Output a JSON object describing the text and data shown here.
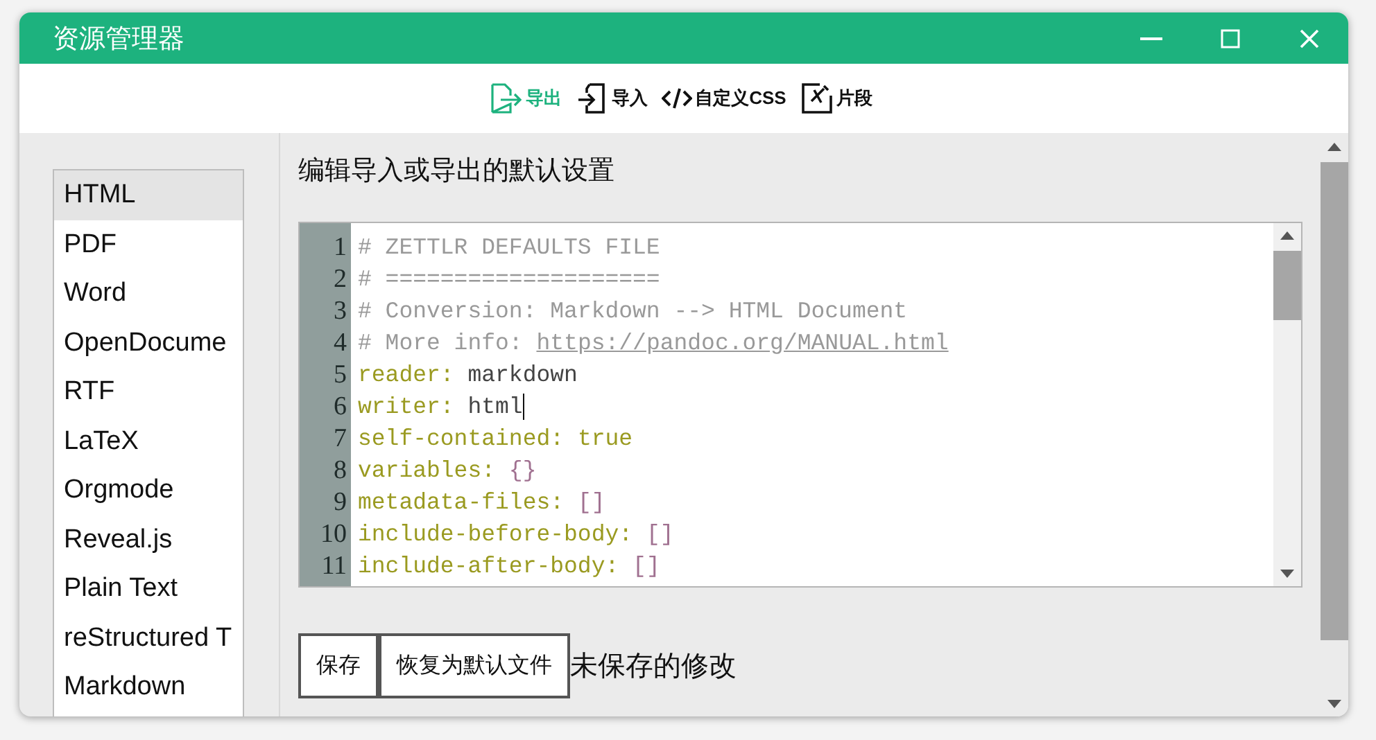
{
  "window": {
    "title": "资源管理器"
  },
  "toolbar": [
    {
      "label": "导出",
      "selected": true
    },
    {
      "label": "导入",
      "selected": false
    },
    {
      "label": "自定义CSS",
      "selected": false
    },
    {
      "label": "片段",
      "selected": false
    }
  ],
  "formats": [
    {
      "label": "HTML",
      "selected": true
    },
    {
      "label": "PDF",
      "selected": false
    },
    {
      "label": "Word",
      "selected": false
    },
    {
      "label": "OpenDocume",
      "selected": false
    },
    {
      "label": "RTF",
      "selected": false
    },
    {
      "label": "LaTeX",
      "selected": false
    },
    {
      "label": "Orgmode",
      "selected": false
    },
    {
      "label": "Reveal.js",
      "selected": false
    },
    {
      "label": "Plain Text",
      "selected": false
    },
    {
      "label": "reStructured T",
      "selected": false
    },
    {
      "label": "Markdown",
      "selected": false
    }
  ],
  "heading": "编辑导入或导出的默认设置",
  "editor": {
    "lines": [
      {
        "number": "1",
        "tokens": [
          {
            "kind": "comment",
            "text": "# ZETTLR DEFAULTS FILE"
          }
        ]
      },
      {
        "number": "2",
        "tokens": [
          {
            "kind": "comment",
            "text": "# ===================="
          }
        ]
      },
      {
        "number": "3",
        "tokens": [
          {
            "kind": "comment",
            "text": "# Conversion: Markdown --> HTML Document"
          }
        ]
      },
      {
        "number": "4",
        "tokens": [
          {
            "kind": "comment",
            "text": "# More info: "
          },
          {
            "kind": "link",
            "text": "https://pandoc.org/MANUAL.html"
          }
        ]
      },
      {
        "number": "5",
        "tokens": [
          {
            "kind": "key",
            "text": "reader: "
          },
          {
            "kind": "plain",
            "text": "markdown"
          }
        ]
      },
      {
        "number": "6",
        "cursor": true,
        "tokens": [
          {
            "kind": "key",
            "text": "writer: "
          },
          {
            "kind": "plain",
            "text": "html"
          }
        ]
      },
      {
        "number": "7",
        "tokens": [
          {
            "kind": "key",
            "text": "self-contained: "
          },
          {
            "kind": "key",
            "text": "true"
          }
        ]
      },
      {
        "number": "8",
        "tokens": [
          {
            "kind": "key",
            "text": "variables: "
          },
          {
            "kind": "bracket",
            "text": "{}"
          }
        ]
      },
      {
        "number": "9",
        "tokens": [
          {
            "kind": "key",
            "text": "metadata-files: "
          },
          {
            "kind": "bracket",
            "text": "[]"
          }
        ]
      },
      {
        "number": "10",
        "tokens": [
          {
            "kind": "key",
            "text": "include-before-body: "
          },
          {
            "kind": "bracket",
            "text": "[]"
          }
        ]
      },
      {
        "number": "11",
        "tokens": [
          {
            "kind": "key",
            "text": "include-after-body: "
          },
          {
            "kind": "bracket",
            "text": "[]"
          }
        ]
      }
    ]
  },
  "buttons": [
    "保存",
    "恢复为默认文件"
  ],
  "status": "未保存的修改"
}
